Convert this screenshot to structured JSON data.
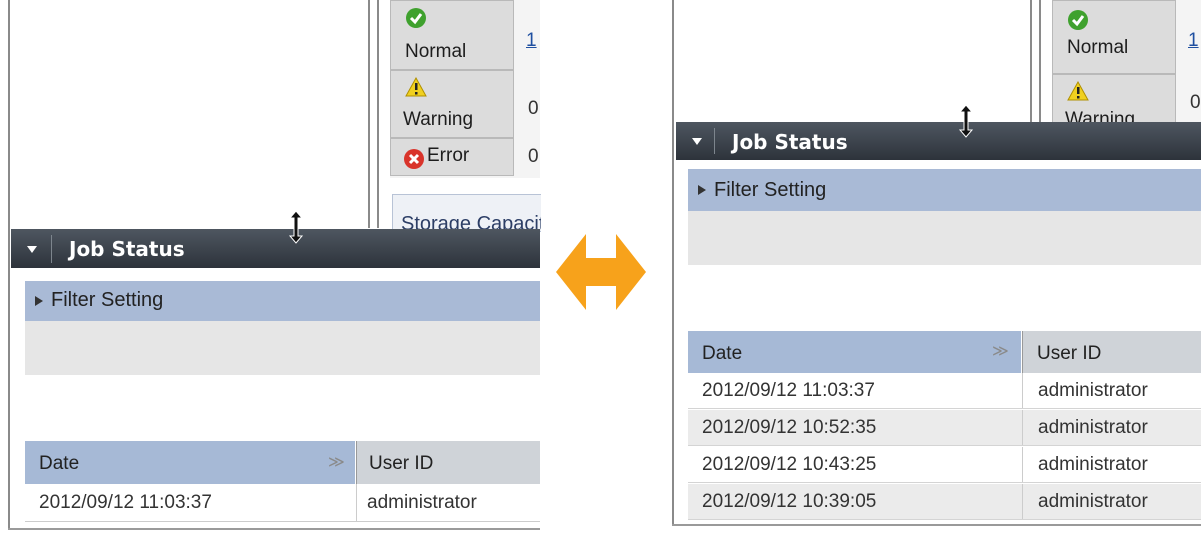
{
  "status": {
    "normal": "Normal",
    "warning": "Warning",
    "error": "Error",
    "normal_value": "1",
    "warning_value": "0",
    "error_value": "0",
    "warning_cropped": "Warning"
  },
  "storage_header": "Storage Capacity",
  "job_status": "Job Status",
  "filter_setting": "Filter Setting",
  "columns": {
    "date": "Date",
    "user_id": "User ID"
  },
  "before": {
    "rows": [
      {
        "date": "2012/09/12 11:03:37",
        "user": "administrator"
      }
    ]
  },
  "after": {
    "rows": [
      {
        "date": "2012/09/12 11:03:37",
        "user": "administrator"
      },
      {
        "date": "2012/09/12 10:52:35",
        "user": "administrator"
      },
      {
        "date": "2012/09/12 10:43:25",
        "user": "administrator"
      },
      {
        "date": "2012/09/12 10:39:05",
        "user": "administrator"
      }
    ]
  },
  "colors": {
    "accent": "#f7a21b",
    "header_bar": "#3a414a",
    "filter_bar": "#a9bad6"
  },
  "icons": [
    "check-circle-icon",
    "warning-triangle-icon",
    "error-x-icon",
    "resize-vertical-cursor-icon",
    "collapse-triangle-icon",
    "expand-triangle-icon",
    "sort-icon",
    "double-arrow-icon"
  ]
}
